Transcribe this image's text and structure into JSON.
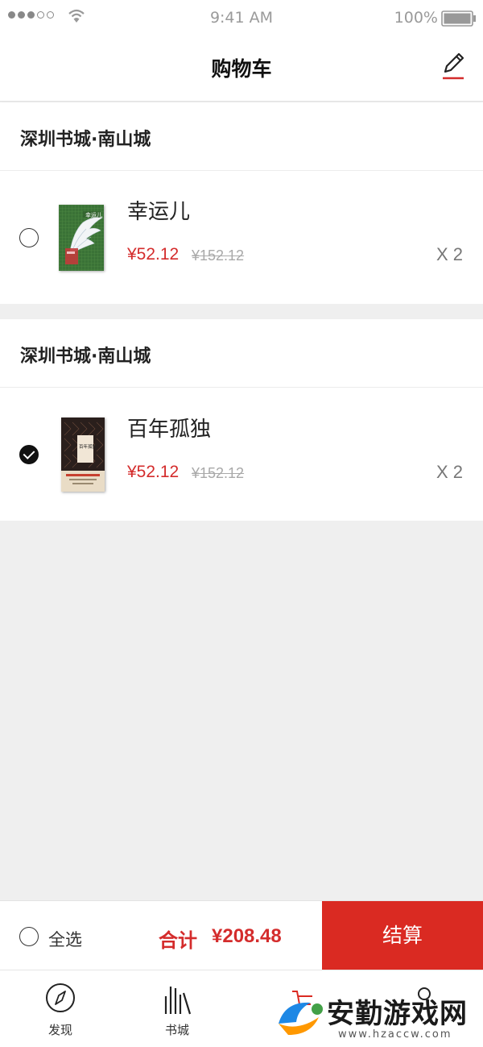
{
  "status_bar": {
    "time": "9:41 AM",
    "battery": "100%"
  },
  "nav": {
    "title": "购物车"
  },
  "stores": [
    {
      "name": "深圳书城·南山城",
      "item": {
        "title": "幸运儿",
        "price": "¥52.12",
        "original_price": "¥152.12",
        "quantity": "X 2",
        "selected": false,
        "cover_text": "幸运儿"
      }
    },
    {
      "name": "深圳书城·南山城",
      "item": {
        "title": "百年孤独",
        "price": "¥52.12",
        "original_price": "¥152.12",
        "quantity": "X 2",
        "selected": true,
        "cover_text": "百年孤独"
      }
    }
  ],
  "footer": {
    "select_all": "全选",
    "total_label": "合计",
    "total_value": "¥208.48",
    "checkout": "结算"
  },
  "tabs": [
    {
      "label": "发现",
      "icon": "compass-icon"
    },
    {
      "label": "书城",
      "icon": "bookshelf-icon"
    },
    {
      "label": "",
      "icon": "cart-icon"
    },
    {
      "label": "",
      "icon": "profile-icon"
    }
  ],
  "watermark": {
    "text": "安勤游戏网",
    "url": "www.hzaccw.com"
  },
  "colors": {
    "accent": "#da2a22",
    "price": "#d42c2c",
    "background": "#efefef"
  }
}
